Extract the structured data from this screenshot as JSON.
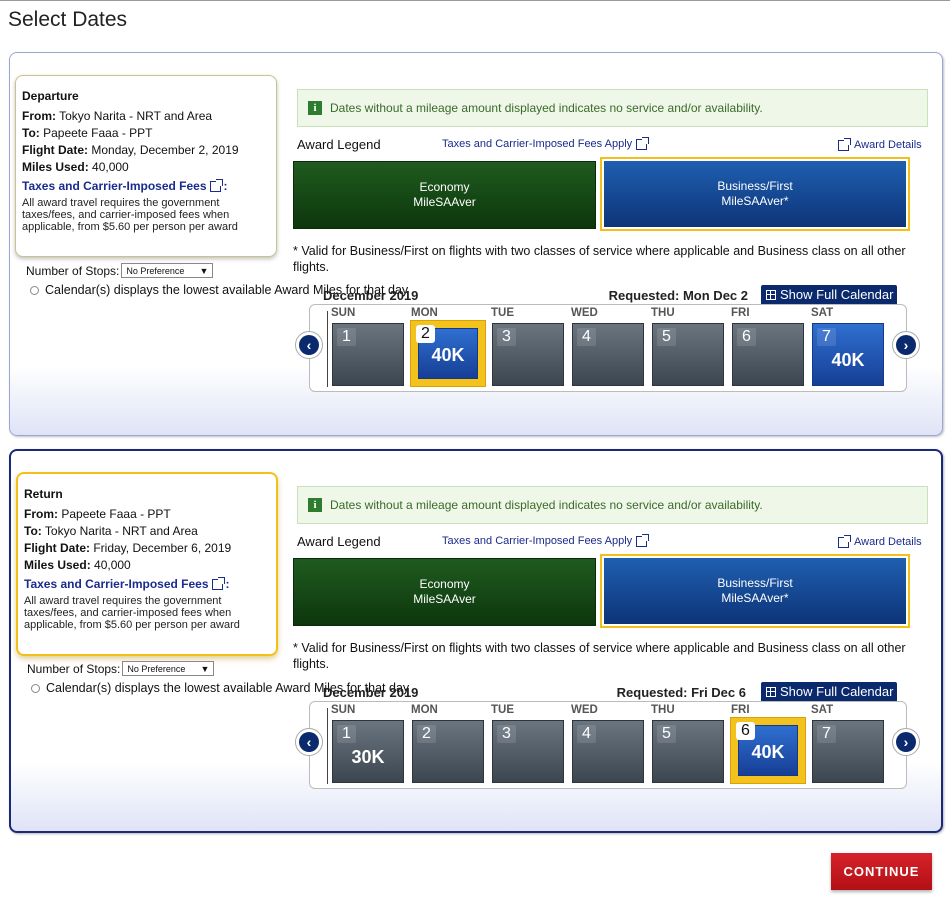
{
  "page": {
    "title": "Select Dates",
    "continue_label": "CONTINUE"
  },
  "common": {
    "notice": "Dates without a mileage amount displayed indicates no service and/or availability.",
    "award_legend": "Award Legend",
    "taxes_link": "Taxes and Carrier-Imposed Fees Apply",
    "award_details": "Award Details",
    "economy_line1": "Economy",
    "economy_line2": "MileSAAver",
    "business_line1": "Business/First",
    "business_line2": "MileSAAver*",
    "valid_note": "* Valid for Business/First on flights with two classes of service where applicable and Business class on all other flights.",
    "stops_label": "Number of Stops:",
    "stops_value": "No Preference",
    "calendar_note": "Calendar(s) displays the lowest available Award Miles for that day",
    "show_full_calendar": "Show Full Calendar",
    "fees_link": "Taxes and Carrier-Imposed Fees",
    "fees_text": "All award travel requires the government taxes/fees, and carrier-imposed fees when applicable, from $5.60 per person per award",
    "from_label": "From:",
    "to_label": "To:",
    "flight_date_label": "Flight Date:",
    "miles_used_label": "Miles Used:",
    "day_names": [
      "SUN",
      "MON",
      "TUE",
      "WED",
      "THU",
      "FRI",
      "SAT"
    ]
  },
  "departure": {
    "heading": "Departure",
    "from": "Tokyo Narita - NRT and Area",
    "to": "Papeete Faaa - PPT",
    "flight_date": "Monday, December 2, 2019",
    "miles_used": "40,000",
    "month": "December 2019",
    "requested": "Requested: Mon Dec 2",
    "days": [
      {
        "num": "1",
        "miles": ""
      },
      {
        "num": "2",
        "miles": "40K"
      },
      {
        "num": "3",
        "miles": ""
      },
      {
        "num": "4",
        "miles": ""
      },
      {
        "num": "5",
        "miles": ""
      },
      {
        "num": "6",
        "miles": ""
      },
      {
        "num": "7",
        "miles": "40K"
      }
    ]
  },
  "return": {
    "heading": "Return",
    "from": "Papeete Faaa - PPT",
    "to": "Tokyo Narita - NRT and Area",
    "flight_date": "Friday, December 6, 2019",
    "miles_used": "40,000",
    "month": "December 2019",
    "requested": "Requested: Fri Dec 6",
    "days": [
      {
        "num": "1",
        "miles": "30K"
      },
      {
        "num": "2",
        "miles": ""
      },
      {
        "num": "3",
        "miles": ""
      },
      {
        "num": "4",
        "miles": ""
      },
      {
        "num": "5",
        "miles": ""
      },
      {
        "num": "6",
        "miles": "40K"
      },
      {
        "num": "7",
        "miles": ""
      }
    ]
  }
}
